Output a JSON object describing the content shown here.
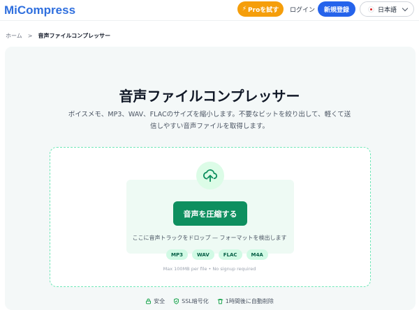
{
  "brand": {
    "name": "MiCompress",
    "color": "#2f6fde"
  },
  "nav": {
    "pro_label": "Proを試す",
    "pro_icon": "lightning-bolt-icon",
    "login_label": "ログイン",
    "signup_label": "新規登録",
    "language": "日本語",
    "language_flag": "japan-flag-icon"
  },
  "breadcrumb": {
    "home": "ホーム",
    "separator": ">",
    "current": "音声ファイルコンプレッサー"
  },
  "hero": {
    "title": "音声ファイルコンプレッサー",
    "subtitle": "ボイスメモ、MP3、WAV、FLACのサイズを縮小します。不要なビットを絞り出して、軽くて送信しやすい音声ファイルを取得します。"
  },
  "upload": {
    "icon": "cloud-upload-icon",
    "button_label": "音声を圧縮する",
    "drop_hint": "ここに音声トラックをドロップ — フォーマットを検出します",
    "formats": [
      "MP3",
      "WAV",
      "FLAC",
      "M4A"
    ],
    "limit_note": "Max 100MB per file • No signup required"
  },
  "trust": [
    {
      "icon": "lock-icon",
      "label": "安全"
    },
    {
      "icon": "shield-check-icon",
      "label": "SSL暗号化"
    },
    {
      "icon": "trash-icon",
      "label": "1時間後に自動削除"
    }
  ],
  "colors": {
    "accent_green": "#0e8f5f",
    "pro_orange": "#f59e0b",
    "signup_blue": "#2563eb",
    "dropzone_border": "#6ee7b7"
  }
}
